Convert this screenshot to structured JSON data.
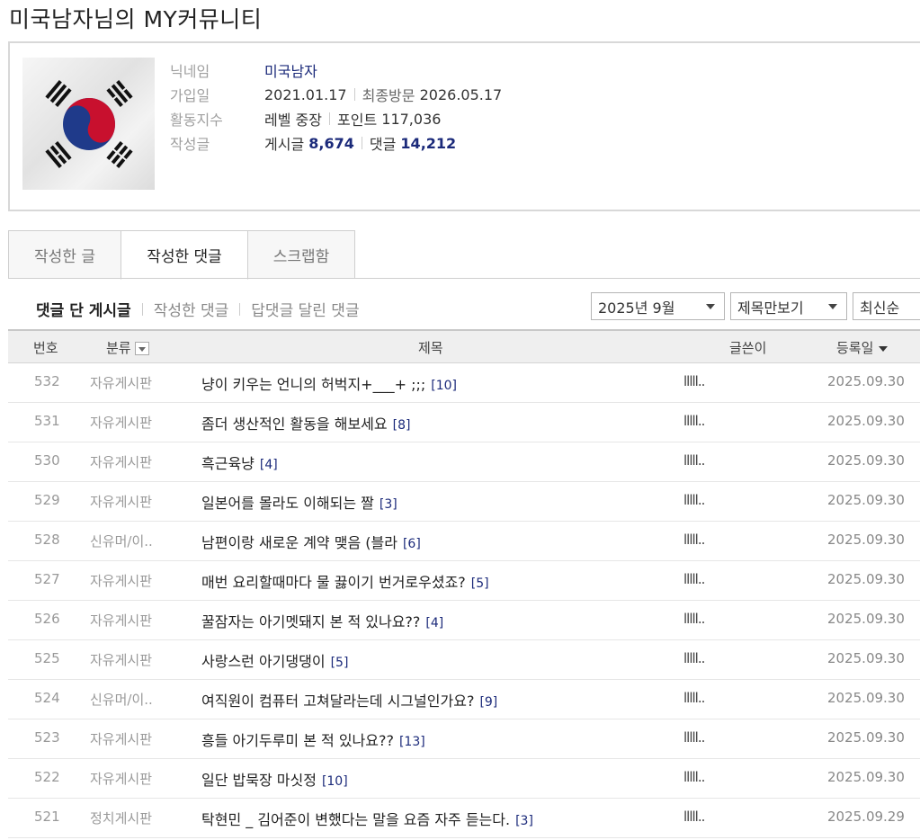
{
  "page_title": "미국남자님의 MY커뮤니티",
  "profile": {
    "labels": {
      "nickname": "닉네임",
      "joined": "가입일",
      "activity": "활동지수",
      "posts": "작성글"
    },
    "nickname": "미국남자",
    "join_date": "2021.01.17",
    "last_visit_label": "최종방문",
    "last_visit": "2026.05.17",
    "level_label": "레벨",
    "level": "중장",
    "points_label": "포인트",
    "points": "117,036",
    "post_label": "게시글",
    "post_count": "8,674",
    "comment_label": "댓글",
    "comment_count": "14,212"
  },
  "tabs": [
    {
      "label": "작성한 글",
      "active": false
    },
    {
      "label": "작성한 댓글",
      "active": true
    },
    {
      "label": "스크랩함",
      "active": false
    }
  ],
  "sub_nav": [
    {
      "label": "댓글 단 게시글",
      "active": true
    },
    {
      "label": "작성한 댓글",
      "active": false
    },
    {
      "label": "답댓글 달린 댓글",
      "active": false
    }
  ],
  "filters": {
    "month": "2025년 9월",
    "view": "제목만보기",
    "sort": "최신순"
  },
  "table": {
    "headers": {
      "num": "번호",
      "category": "분류",
      "title": "제목",
      "writer": "글쓴이",
      "date": "등록일"
    },
    "rows": [
      {
        "num": "532",
        "category": "자유게시판",
        "title": "냥이 키우는 언니의 허벅지+___+ ;;;",
        "comments": "[10]",
        "writer": "lllll..",
        "date": "2025.09.30"
      },
      {
        "num": "531",
        "category": "자유게시판",
        "title": "좀더 생산적인 활동을 해보세요",
        "comments": "[8]",
        "writer": "lllll..",
        "date": "2025.09.30"
      },
      {
        "num": "530",
        "category": "자유게시판",
        "title": "흑근육냥",
        "comments": "[4]",
        "writer": "lllll..",
        "date": "2025.09.30"
      },
      {
        "num": "529",
        "category": "자유게시판",
        "title": "일본어를 몰라도 이해되는 짤",
        "comments": "[3]",
        "writer": "lllll..",
        "date": "2025.09.30"
      },
      {
        "num": "528",
        "category": "신유머/이..",
        "title": "남편이랑 새로운 계약 맺음 (블라",
        "comments": "[6]",
        "writer": "lllll..",
        "date": "2025.09.30"
      },
      {
        "num": "527",
        "category": "자유게시판",
        "title": "매번 요리할때마다 물 끓이기 번거로우셨죠?",
        "comments": "[5]",
        "writer": "lllll..",
        "date": "2025.09.30"
      },
      {
        "num": "526",
        "category": "자유게시판",
        "title": "꿀잠자는 아기멧돼지 본 적 있나요??",
        "comments": "[4]",
        "writer": "lllll..",
        "date": "2025.09.30"
      },
      {
        "num": "525",
        "category": "자유게시판",
        "title": "사랑스런 아기댕댕이",
        "comments": "[5]",
        "writer": "lllll..",
        "date": "2025.09.30"
      },
      {
        "num": "524",
        "category": "신유머/이..",
        "title": "여직원이 컴퓨터 고쳐달라는데 시그널인가요?",
        "comments": "[9]",
        "writer": "lllll..",
        "date": "2025.09.30"
      },
      {
        "num": "523",
        "category": "자유게시판",
        "title": "흥들 아기두루미 본 적 있나요??",
        "comments": "[13]",
        "writer": "lllll..",
        "date": "2025.09.30"
      },
      {
        "num": "522",
        "category": "자유게시판",
        "title": "일단 밥묵장 마싯정",
        "comments": "[10]",
        "writer": "lllll..",
        "date": "2025.09.30"
      },
      {
        "num": "521",
        "category": "정치게시판",
        "title": "탁현민 _ 김어준이 변했다는 말을 요즘 자주 듣는다.",
        "comments": "[3]",
        "writer": "lllll..",
        "date": "2025.09.29"
      }
    ]
  },
  "colors": {
    "accent": "#1b2a7a",
    "flag_red": "#c8102e",
    "flag_blue": "#1f3a8a"
  },
  "icons": {
    "avatar": "korean-flag-avatar",
    "dropdown": "chevron-down-icon",
    "sort": "sort-desc-icon"
  }
}
